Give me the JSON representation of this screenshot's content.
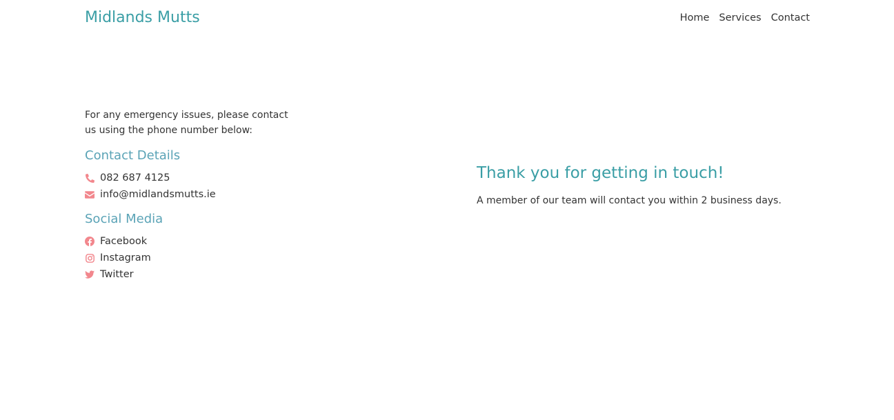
{
  "header": {
    "brand": "Midlands Mutts",
    "nav": [
      "Home",
      "Services",
      "Contact"
    ]
  },
  "contact": {
    "intro": "For any emergency issues, please contact us using the phone number below:",
    "details_heading": "Contact Details",
    "phone": "082 687 4125",
    "email": "info@midlandsmutts.ie",
    "social_heading": "Social Media",
    "social": [
      "Facebook",
      "Instagram",
      "Twitter"
    ]
  },
  "confirmation": {
    "heading": "Thank you for getting in touch!",
    "message": "A member of our team will contact you within 2 business days."
  },
  "colors": {
    "brand": "#3a9ea5",
    "section_heading": "#5aa3b6",
    "icon": "#f2878d",
    "text": "#333333"
  },
  "icons": {
    "phone": "phone-icon",
    "email": "envelope-icon",
    "facebook": "facebook-icon",
    "instagram": "instagram-icon",
    "twitter": "twitter-icon"
  }
}
